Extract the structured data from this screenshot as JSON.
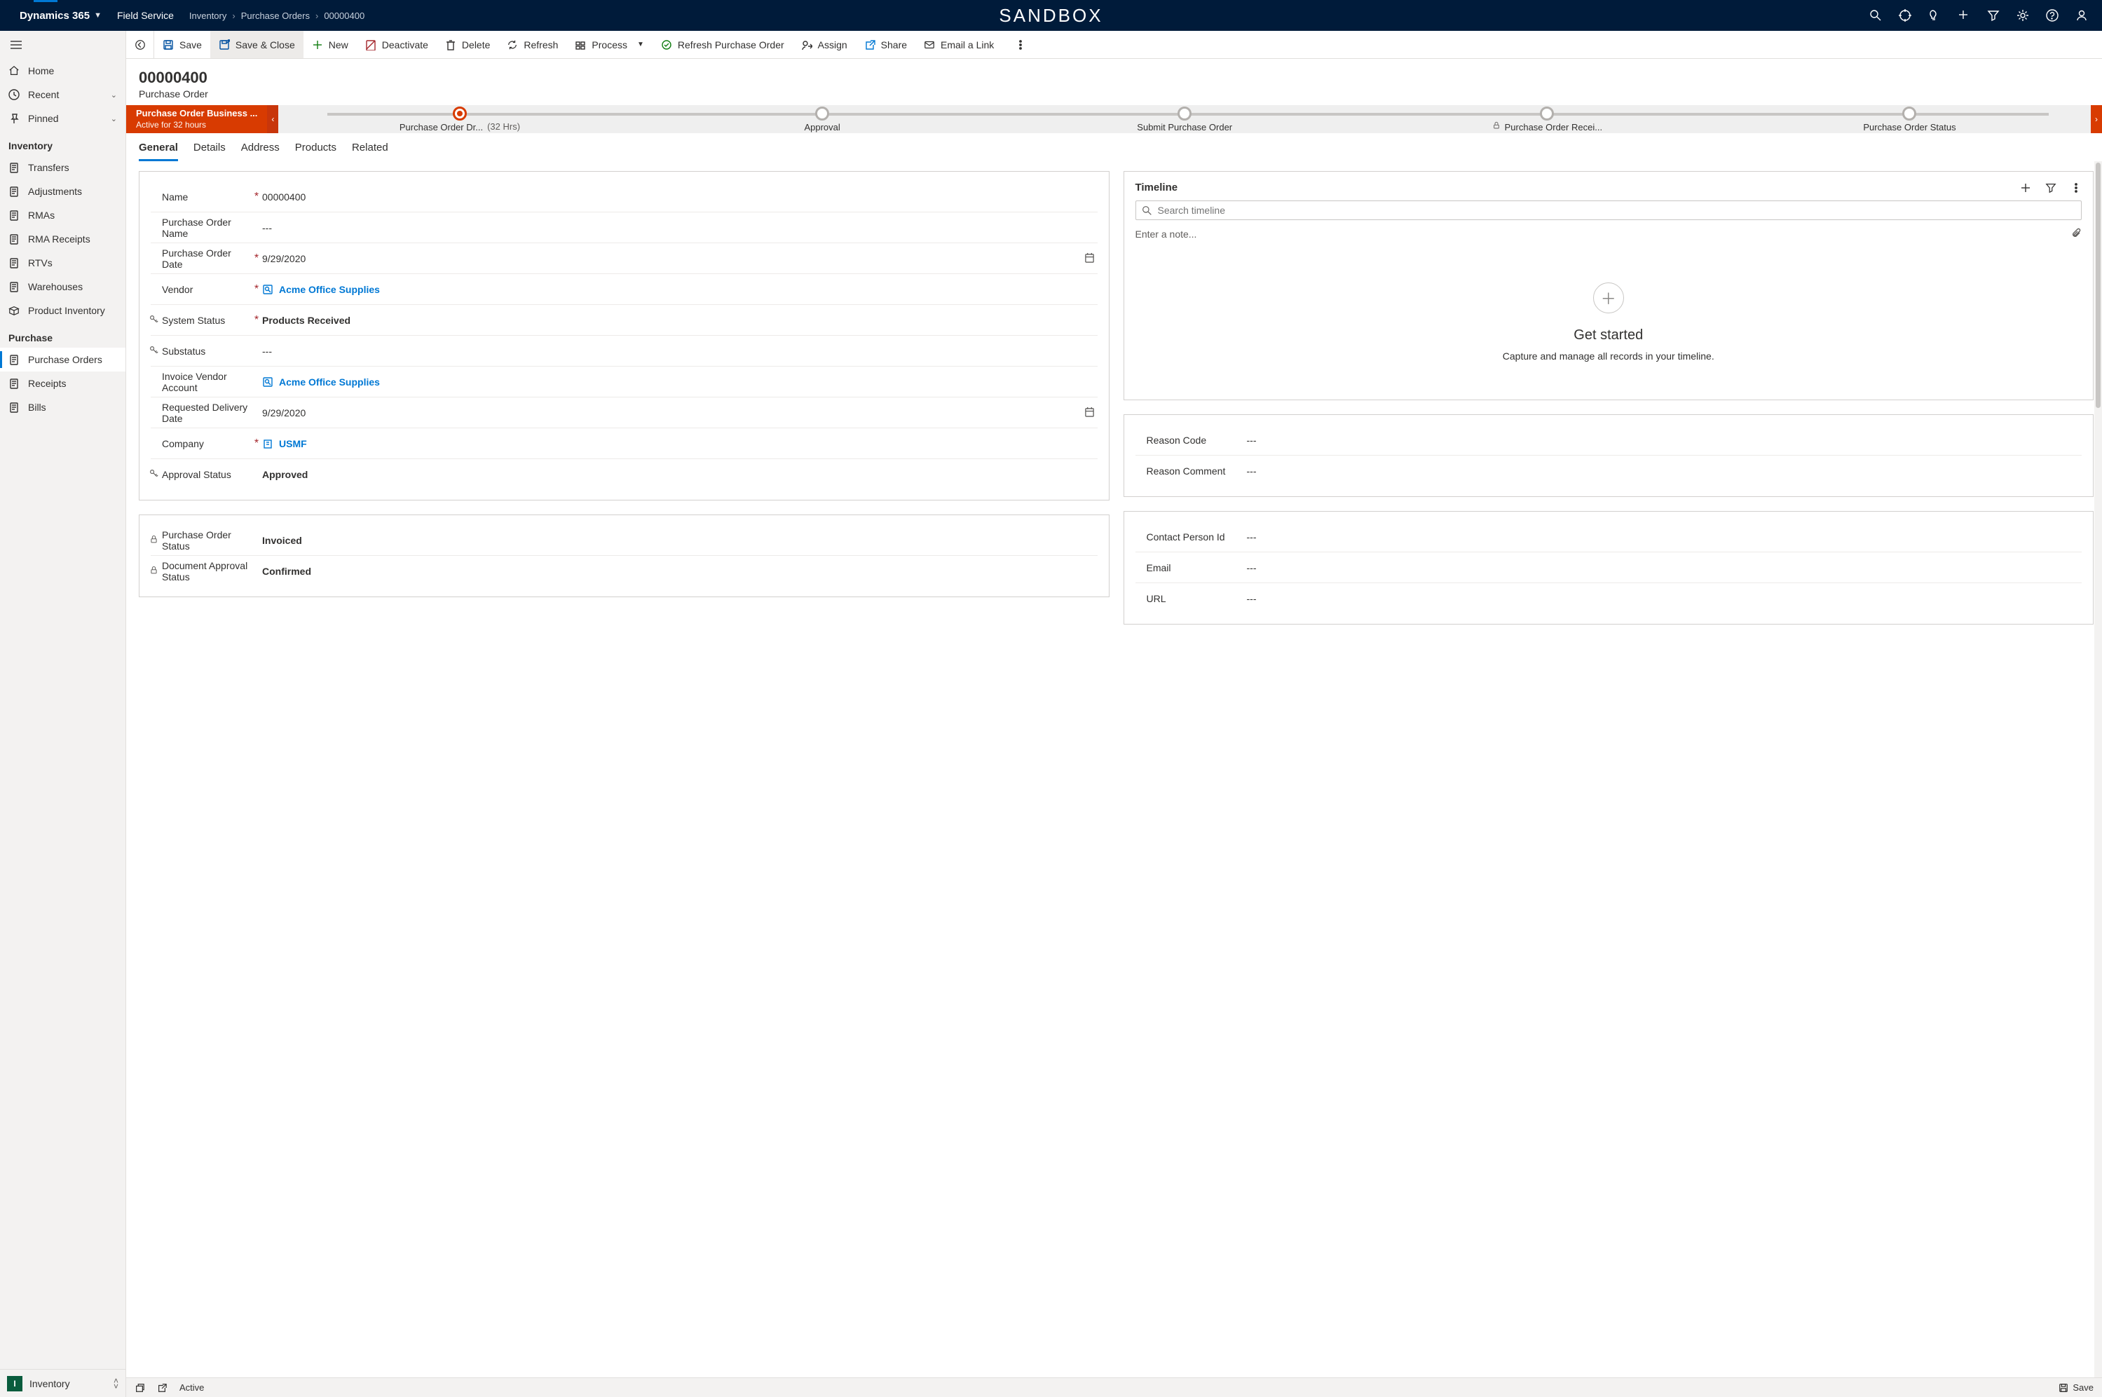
{
  "top": {
    "brand": "Dynamics 365",
    "module": "Field Service",
    "env": "SANDBOX",
    "breadcrumbs": [
      "Inventory",
      "Purchase Orders",
      "00000400"
    ]
  },
  "sidebar": {
    "home": "Home",
    "recent": "Recent",
    "pinned": "Pinned",
    "section_inventory": "Inventory",
    "inv_items": [
      "Transfers",
      "Adjustments",
      "RMAs",
      "RMA Receipts",
      "RTVs",
      "Warehouses",
      "Product Inventory"
    ],
    "section_purchase": "Purchase",
    "pur_items": [
      "Purchase Orders",
      "Receipts",
      "Bills"
    ],
    "area_badge": "I",
    "area_label": "Inventory"
  },
  "cmd": {
    "save": "Save",
    "save_close": "Save & Close",
    "new": "New",
    "deactivate": "Deactivate",
    "delete": "Delete",
    "refresh": "Refresh",
    "process": "Process",
    "refresh_po": "Refresh Purchase Order",
    "assign": "Assign",
    "share": "Share",
    "email": "Email a Link"
  },
  "record": {
    "number": "00000400",
    "entity": "Purchase Order"
  },
  "bpf": {
    "name": "Purchase Order Business ...",
    "duration": "Active for 32 hours",
    "stage1": "Purchase Order Dr...",
    "stage1_dur": "(32 Hrs)",
    "stage2": "Approval",
    "stage3": "Submit Purchase Order",
    "stage4": "Purchase Order Recei...",
    "stage5": "Purchase Order Status"
  },
  "tabs": [
    "General",
    "Details",
    "Address",
    "Products",
    "Related"
  ],
  "form": {
    "name_lbl": "Name",
    "name_val": "00000400",
    "poname_lbl": "Purchase Order Name",
    "dash": "---",
    "podate_lbl": "Purchase Order Date",
    "podate_val": "9/29/2020",
    "vendor_lbl": "Vendor",
    "vendor_val": "Acme Office Supplies",
    "sysstat_lbl": "System Status",
    "sysstat_val": "Products Received",
    "substat_lbl": "Substatus",
    "invvend_lbl": "Invoice Vendor Account",
    "invvend_val": "Acme Office Supplies",
    "reqdate_lbl": "Requested Delivery Date",
    "reqdate_val": "9/29/2020",
    "company_lbl": "Company",
    "company_val": "USMF",
    "apprstat_lbl": "Approval Status",
    "apprstat_val": "Approved",
    "postat_lbl": "Purchase Order Status",
    "postat_val": "Invoiced",
    "docappr_lbl": "Document Approval Status",
    "docappr_val": "Confirmed"
  },
  "timeline": {
    "title": "Timeline",
    "search_ph": "Search timeline",
    "note_ph": "Enter a note...",
    "empty_h": "Get started",
    "empty_s": "Capture and manage all records in your timeline."
  },
  "extra": {
    "reason_code_lbl": "Reason Code",
    "reason_comment_lbl": "Reason Comment",
    "contact_lbl": "Contact Person Id",
    "email_lbl": "Email",
    "url_lbl": "URL"
  },
  "footer": {
    "status": "Active",
    "save": "Save"
  }
}
